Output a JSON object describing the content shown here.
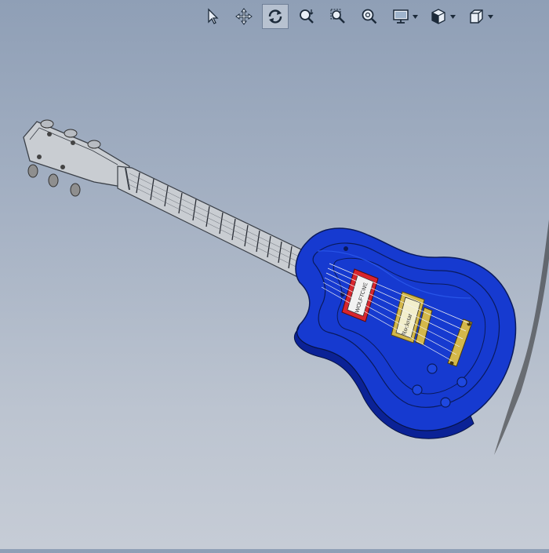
{
  "app": {
    "title": ""
  },
  "toolbar": {
    "buttons": [
      {
        "name": "select",
        "icon": "select-cursor-icon",
        "active": false
      },
      {
        "name": "pan",
        "icon": "pan-move-icon",
        "active": false
      },
      {
        "name": "rotate",
        "icon": "rotate-view-icon",
        "active": true
      },
      {
        "name": "zoom-in-out",
        "icon": "zoom-in-out-icon",
        "active": false
      },
      {
        "name": "zoom-to-area",
        "icon": "zoom-to-area-icon",
        "active": false
      },
      {
        "name": "zoom-to-fit",
        "icon": "zoom-to-fit-icon",
        "active": false
      },
      {
        "name": "display-style",
        "icon": "display-style-icon",
        "active": false,
        "dropdown": true
      },
      {
        "name": "view-settings",
        "icon": "view-settings-icon",
        "active": false,
        "dropdown": true
      },
      {
        "name": "view-orientation",
        "icon": "view-orientation-icon",
        "active": false,
        "dropdown": true
      }
    ]
  },
  "model": {
    "body_color": "#1a3fd6",
    "neck_color": "#c9cdd2",
    "pickup_labels": [
      "WOLFTONE",
      "Rockstar"
    ],
    "accent_gold": "#d4b84a",
    "accent_red": "#d8262e"
  }
}
